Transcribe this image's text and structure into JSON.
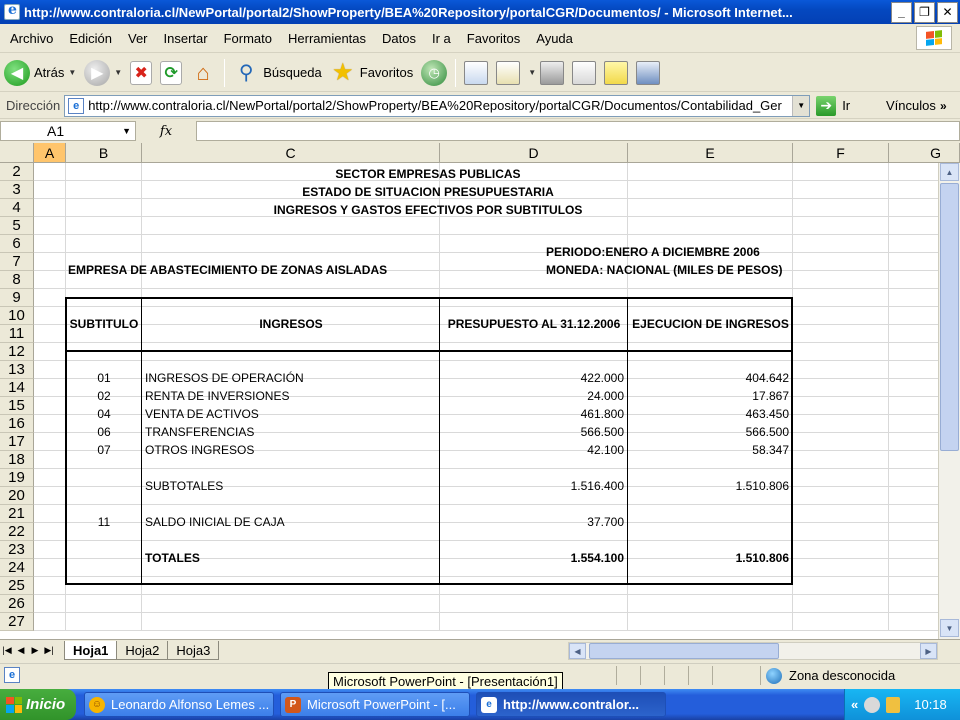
{
  "window": {
    "title": "http://www.contraloria.cl/NewPortal/portal2/ShowProperty/BEA%20Repository/portalCGR/Documentos/ - Microsoft Internet...",
    "minimize": "_",
    "maximize": "❐",
    "close": "✕"
  },
  "menu": [
    "Archivo",
    "Edición",
    "Ver",
    "Insertar",
    "Formato",
    "Herramientas",
    "Datos",
    "Ir a",
    "Favoritos",
    "Ayuda"
  ],
  "toolbar": {
    "back_label": "Atrás",
    "search_label": "Búsqueda",
    "favorites_label": "Favoritos"
  },
  "address": {
    "label": "Dirección",
    "url": "http://www.contraloria.cl/NewPortal/portal2/ShowProperty/BEA%20Repository/portalCGR/Documentos/Contabilidad_Ger",
    "go_label": "Ir",
    "links_label": "Vínculos",
    "links_more": "»"
  },
  "formula": {
    "cell_ref": "A1",
    "fx": "fx"
  },
  "grid": {
    "columns": [
      "A",
      "B",
      "C",
      "D",
      "E",
      "F",
      "G"
    ],
    "active_column": "A",
    "rows": [
      "2",
      "3",
      "4",
      "5",
      "6",
      "7",
      "8",
      "9",
      "10",
      "11",
      "12",
      "13",
      "14",
      "15",
      "16",
      "17",
      "18",
      "19",
      "20",
      "21",
      "22",
      "23",
      "24",
      "25",
      "26",
      "27"
    ]
  },
  "report": {
    "title1": "SECTOR EMPRESAS PUBLICAS",
    "title2": "ESTADO DE SITUACION PRESUPUESTARIA",
    "title3": "INGRESOS Y GASTOS EFECTIVOS  POR SUBTITULOS",
    "period": "PERIODO:ENERO A DICIEMBRE  2006",
    "company": "EMPRESA DE ABASTECIMIENTO DE ZONAS AISLADAS",
    "currency": "MONEDA: NACIONAL (MILES DE PESOS)",
    "headers": {
      "subtitulo": "SUBTITULO",
      "ingresos": "INGRESOS",
      "presupuesto": "PRESUPUESTO AL 31.12.2006",
      "ejecucion": "EJECUCION DE INGRESOS"
    },
    "rows": [
      {
        "code": "01",
        "name": "INGRESOS DE OPERACIÓN",
        "budget": "422.000",
        "exec": "404.642"
      },
      {
        "code": "02",
        "name": "RENTA DE INVERSIONES",
        "budget": "24.000",
        "exec": "17.867"
      },
      {
        "code": "04",
        "name": "VENTA DE ACTIVOS",
        "budget": "461.800",
        "exec": "463.450"
      },
      {
        "code": "06",
        "name": "TRANSFERENCIAS",
        "budget": "566.500",
        "exec": "566.500"
      },
      {
        "code": "07",
        "name": "OTROS INGRESOS",
        "budget": "42.100",
        "exec": "58.347"
      }
    ],
    "subtotal": {
      "name": "SUBTOTALES",
      "budget": "1.516.400",
      "exec": "1.510.806"
    },
    "saldo": {
      "code": "11",
      "name": "SALDO INICIAL DE CAJA",
      "budget": "37.700"
    },
    "total": {
      "name": "TOTALES",
      "budget": "1.554.100",
      "exec": "1.510.806"
    }
  },
  "sheets": [
    "Hoja1",
    "Hoja2",
    "Hoja3"
  ],
  "active_sheet": "Hoja1",
  "status": {
    "zone": "Zona desconocida",
    "tooltip": "Microsoft PowerPoint - [Presentación1]"
  },
  "taskbar": {
    "start": "Inicio",
    "tasks": [
      "Leonardo Alfonso Lemes ...",
      "Microsoft PowerPoint - [...",
      "http://www.contralor..."
    ],
    "active_task": 2,
    "tray_more": "«",
    "clock": "10:18"
  }
}
